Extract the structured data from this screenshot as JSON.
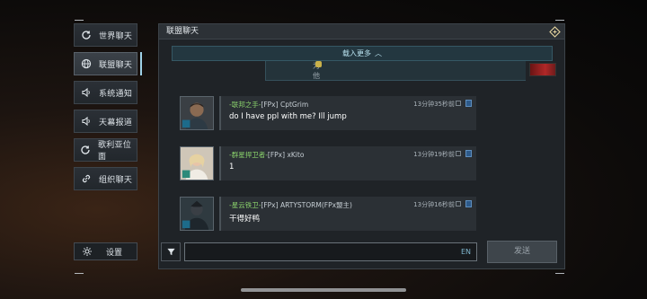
{
  "sidebar": {
    "items": [
      {
        "label": "世界聊天",
        "icon": "refresh-icon"
      },
      {
        "label": "联盟聊天",
        "icon": "globe-icon",
        "active": true
      },
      {
        "label": "系统通知",
        "icon": "speaker-icon"
      },
      {
        "label": "天幕报道",
        "icon": "speaker-icon"
      },
      {
        "label": "歌利亚位面",
        "icon": "refresh-icon"
      },
      {
        "label": "组织聊天",
        "icon": "link-icon"
      }
    ],
    "settings_label": "设置"
  },
  "panel": {
    "title": "联盟聊天",
    "load_more": "载入更多",
    "previous_message_partial": "为他们带来操纵!"
  },
  "messages": [
    {
      "prefix": "-联邦之手-",
      "tag": "[FPx]",
      "name": "CptGrim",
      "time": "13分钟35秒前",
      "text": "do I have ppl with me? Ill jump"
    },
    {
      "prefix": "-群星捍卫者-",
      "tag": "[FPx]",
      "name": "xKito",
      "time": "13分钟19秒前",
      "text": "1"
    },
    {
      "prefix": "-星云铁卫-",
      "tag": "[FPx]",
      "name": "ARTYSTORM(FPx盟主)",
      "time": "13分钟16秒前",
      "text": "干得好鸭"
    }
  ],
  "composer": {
    "lang": "EN",
    "send_label": "发送"
  },
  "colors": {
    "accent": "#9fd2e8",
    "name_green": "#8ad26c",
    "panel_bg": "#1f2327"
  }
}
